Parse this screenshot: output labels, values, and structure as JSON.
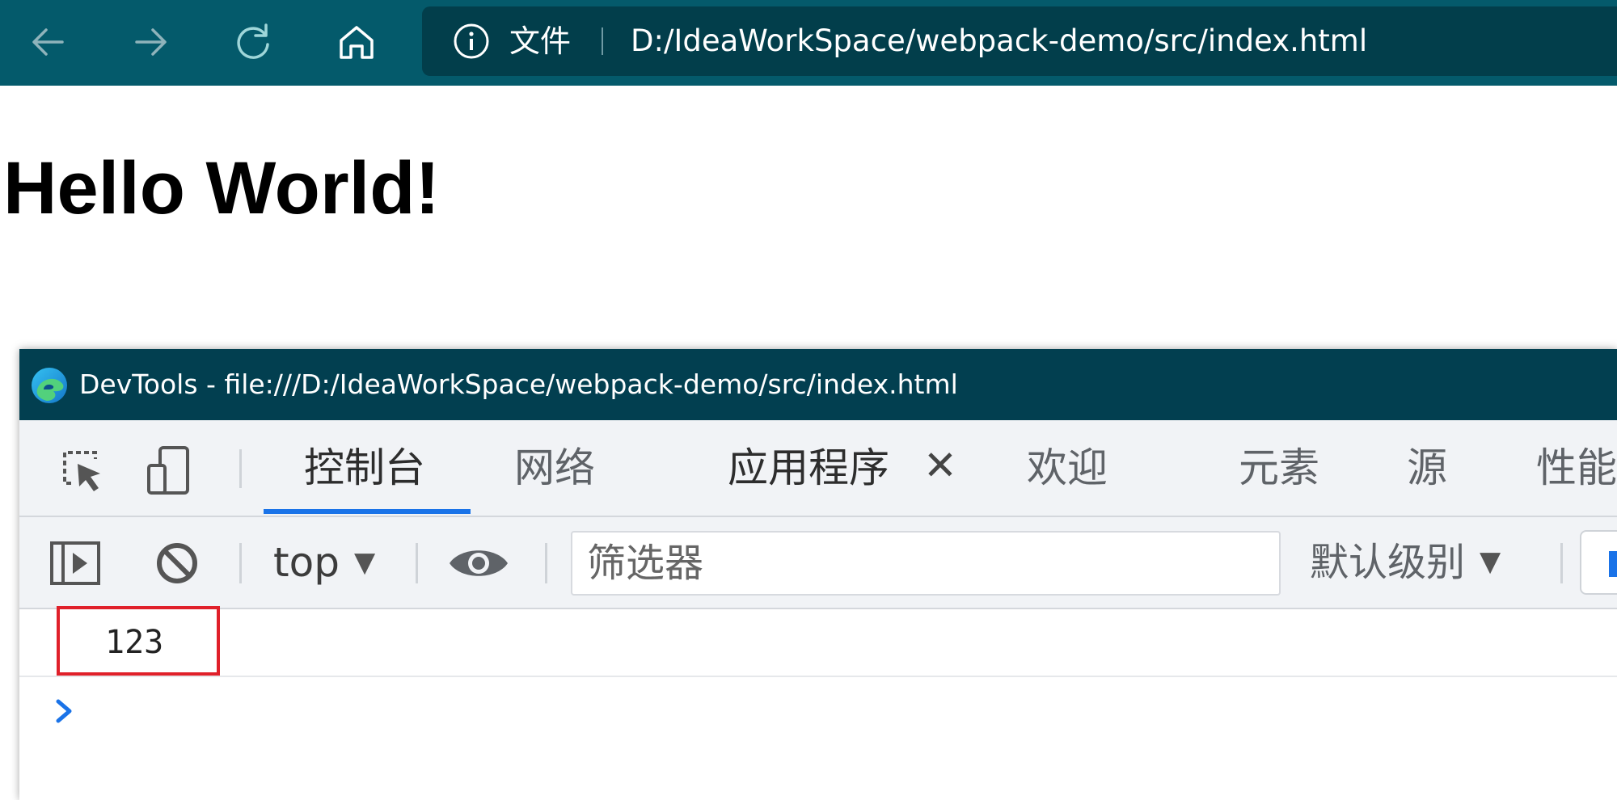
{
  "browser": {
    "nav": {
      "back_icon": "arrow-left-icon",
      "forward_icon": "arrow-right-icon",
      "refresh_icon": "refresh-icon",
      "home_icon": "home-icon"
    },
    "address_bar": {
      "info_icon": "info-icon",
      "scheme_label": "文件",
      "url": "D:/IdeaWorkSpace/webpack-demo/src/index.html"
    }
  },
  "page": {
    "heading": "Hello World!"
  },
  "devtools": {
    "window_title": "DevTools - file:///D:/IdeaWorkSpace/webpack-demo/src/index.html",
    "tabs": [
      {
        "label": "控制台",
        "active": true
      },
      {
        "label": "网络"
      },
      {
        "label": "应用程序",
        "closable": true,
        "close_glyph": "✕"
      },
      {
        "label": "欢迎"
      },
      {
        "label": "元素"
      },
      {
        "label": "源"
      },
      {
        "label": "性能"
      }
    ],
    "toolbar": {
      "context_value": "top",
      "context_caret": "▼",
      "filter_placeholder": "筛选器",
      "level_value": "默认级别",
      "level_caret": "▼"
    },
    "console": {
      "messages": [
        {
          "text": "123",
          "highlighted": true
        }
      ],
      "prompt_icon": "chevron-right-icon"
    },
    "colors": {
      "titlebar": "#023f50",
      "accent": "#1a73e8",
      "highlight": "#e0202a"
    }
  }
}
